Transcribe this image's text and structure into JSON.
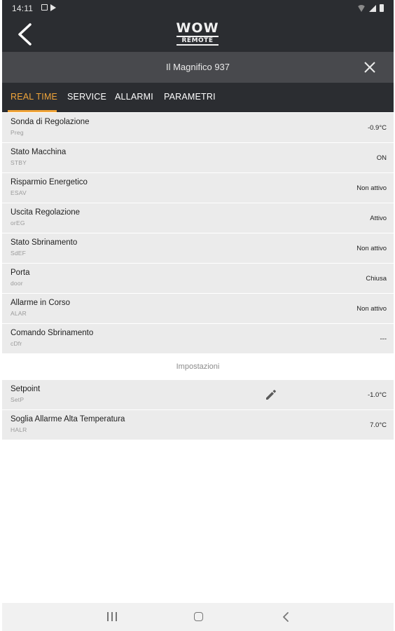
{
  "status_bar": {
    "time": "14:11",
    "left_icons": [
      "image-icon",
      "play-store-icon"
    ],
    "right_icons": [
      "wifi-icon",
      "signal-icon",
      "battery-icon"
    ]
  },
  "header": {
    "back_icon": "back-arrow-icon",
    "logo_line1": "WOW",
    "logo_line2": "REMOTE"
  },
  "device_bar": {
    "device_name": "Il Magnifico 937",
    "close_icon": "close-icon"
  },
  "tabs": [
    {
      "label": "REAL TIME",
      "active": true
    },
    {
      "label": "SERVICE",
      "active": false
    },
    {
      "label": "ALLARMI",
      "active": false
    },
    {
      "label": "PARAMETRI",
      "active": false
    }
  ],
  "colors": {
    "accent": "#f0a53a",
    "header_bg": "#2b2d31",
    "device_bar_bg": "#48494d",
    "row_bg": "#ebebeb"
  },
  "realtime_rows": [
    {
      "label": "Sonda di Regolazione",
      "code": "Preg",
      "value": "-0.9°C"
    },
    {
      "label": "Stato Macchina",
      "code": "STBY",
      "value": "ON"
    },
    {
      "label": "Risparmio Energetico",
      "code": "ESAV",
      "value": "Non attivo"
    },
    {
      "label": "Uscita Regolazione",
      "code": "orEG",
      "value": "Attivo"
    },
    {
      "label": "Stato Sbrinamento",
      "code": "SdEF",
      "value": "Non attivo"
    },
    {
      "label": "Porta",
      "code": "door",
      "value": "Chiusa"
    },
    {
      "label": "Allarme in Corso",
      "code": "ALAR",
      "value": "Non attivo"
    },
    {
      "label": "Comando Sbrinamento",
      "code": "cDfr",
      "value": "---"
    }
  ],
  "settings": {
    "section_title": "Impostazioni",
    "rows": [
      {
        "label": "Setpoint",
        "code": "SetP",
        "value": "-1.0°C",
        "edit_icon": "pencil-icon"
      },
      {
        "label": "Soglia Allarme Alta Temperatura",
        "code": "HALR",
        "value": "7.0°C"
      }
    ]
  },
  "nav_bar": {
    "icons": [
      "recents-icon",
      "home-icon",
      "back-icon"
    ]
  }
}
